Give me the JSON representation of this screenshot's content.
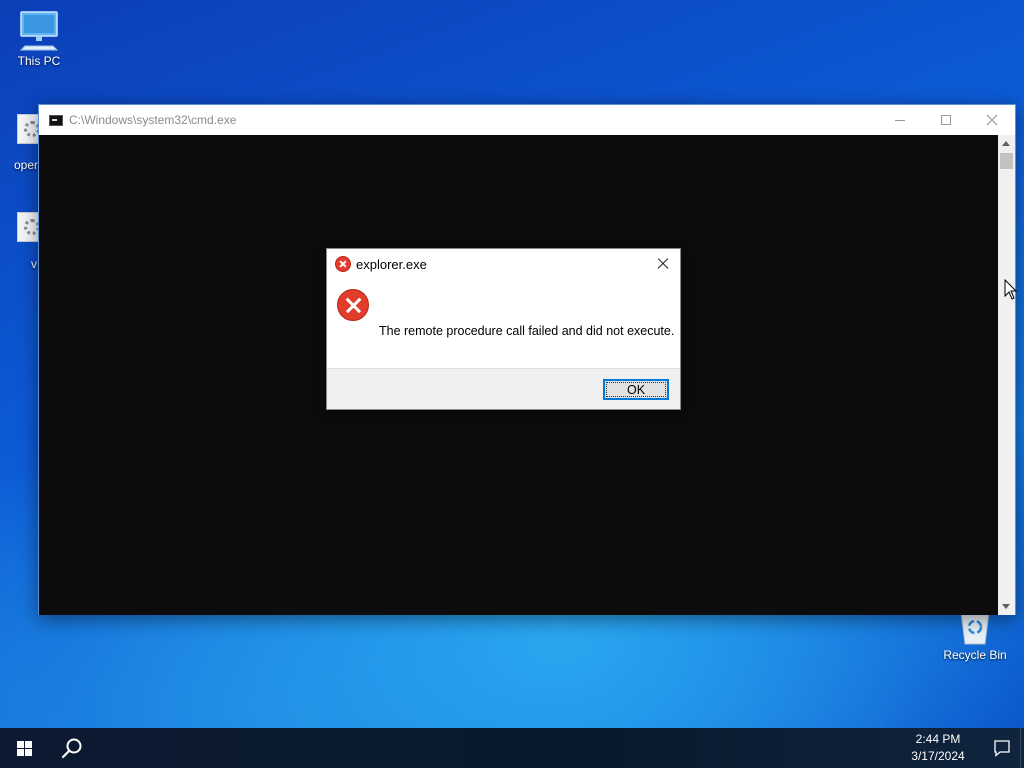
{
  "desktop": {
    "icons": [
      {
        "label": "This PC"
      },
      {
        "label": "oper"
      },
      {
        "label": "v"
      },
      {
        "label": "Recycle Bin"
      }
    ]
  },
  "cmd_window": {
    "title": "C:\\Windows\\system32\\cmd.exe",
    "console_text": ""
  },
  "error_dialog": {
    "title": "explorer.exe",
    "message": "The remote procedure call failed and did not execute.",
    "ok_label": "OK"
  },
  "taskbar": {
    "time": "2:44 PM",
    "date": "3/17/2024"
  },
  "colors": {
    "accent": "#0078d7",
    "error_red": "#e23c2a",
    "console_bg": "#0c0c0c"
  }
}
